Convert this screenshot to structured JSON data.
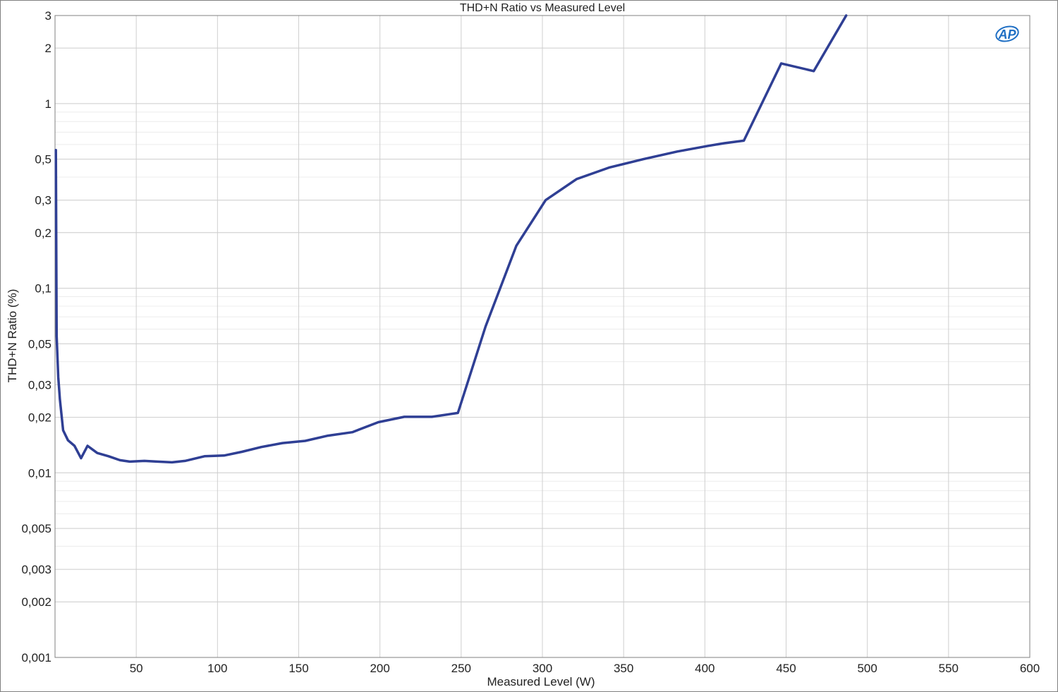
{
  "colors": {
    "series": "#2f3f94",
    "major_grid": "#cfcfcf",
    "minor_grid": "#ececec",
    "axis": "#808080",
    "logo": "#1f6fc4"
  },
  "logo": {
    "text": "AP"
  },
  "chart_data": {
    "type": "line",
    "title": "THD+N Ratio vs Measured Level",
    "xlabel": "Measured Level (W)",
    "ylabel": "THD+N Ratio (%)",
    "xlim": [
      0,
      600
    ],
    "ylim": [
      0.001,
      3
    ],
    "yscale": "log",
    "grid": true,
    "x_ticks": [
      50,
      100,
      150,
      200,
      250,
      300,
      350,
      400,
      450,
      500,
      550,
      600
    ],
    "x_tick_labels": [
      "50",
      "100",
      "150",
      "200",
      "250",
      "300",
      "350",
      "400",
      "450",
      "500",
      "550",
      "600"
    ],
    "y_ticks": [
      0.001,
      0.002,
      0.003,
      0.005,
      0.01,
      0.02,
      0.03,
      0.05,
      0.1,
      0.2,
      0.3,
      0.5,
      1,
      2,
      3
    ],
    "y_tick_labels": [
      "0,001",
      "0,002",
      "0,003",
      "0,005",
      "0,01",
      "0,02",
      "0,03",
      "0,05",
      "0,1",
      "0,2",
      "0,3",
      "0,5",
      "1",
      "2",
      "3"
    ],
    "series": [
      {
        "x": [
          0.5,
          1,
          2,
          3,
          5,
          8,
          12,
          16,
          20,
          26,
          33,
          40,
          46,
          55,
          63,
          72,
          80,
          92,
          104,
          115,
          127,
          140,
          154,
          168,
          183,
          199,
          215,
          232,
          248,
          265,
          284,
          302,
          321,
          341,
          362,
          383,
          402,
          412,
          424,
          447,
          467,
          487
        ],
        "y": [
          0.56,
          0.055,
          0.033,
          0.025,
          0.017,
          0.015,
          0.014,
          0.012,
          0.014,
          0.0128,
          0.0123,
          0.0117,
          0.0115,
          0.0116,
          0.0115,
          0.0114,
          0.0116,
          0.0123,
          0.0124,
          0.013,
          0.0138,
          0.0145,
          0.0149,
          0.0159,
          0.0166,
          0.0188,
          0.0201,
          0.0201,
          0.0211,
          0.062,
          0.17,
          0.3,
          0.39,
          0.45,
          0.5,
          0.55,
          0.59,
          0.61,
          0.63,
          1.65,
          1.5,
          3.0
        ]
      }
    ]
  }
}
